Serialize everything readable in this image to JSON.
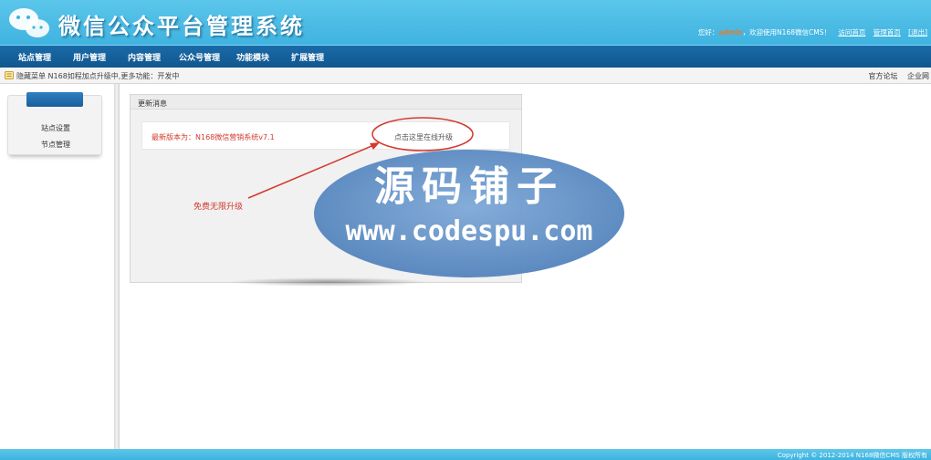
{
  "header": {
    "title": "微信公众平台管理系统",
    "greeting_prefix": "您好：",
    "user": "admin",
    "greeting_suffix": "，欢迎使用N168微信CMS！",
    "links": [
      "访问首页",
      "管理首页",
      "[退出]"
    ]
  },
  "nav": {
    "items": [
      "站点管理",
      "用户管理",
      "内容管理",
      "公众号管理",
      "功能模块",
      "扩展管理"
    ]
  },
  "notice": {
    "text": "隐藏菜单 N168如程加点升级中,更多功能：开发中",
    "right_links": [
      "官方论坛",
      "企业网"
    ]
  },
  "sidebar": {
    "items": [
      "站点设置",
      "节点管理"
    ]
  },
  "panel": {
    "title": "更新消息",
    "version_text": "最新版本为：N168微信营销系统v7.1",
    "upgrade_link": "点击这里在线升级"
  },
  "annotation": {
    "label": "免费无限升级"
  },
  "watermark": {
    "cn": "源码铺子",
    "url": "www.codespu.com"
  },
  "footer": {
    "copyright": "Copyright © 2012-2014 N168微信CMS 版权所有"
  },
  "colors": {
    "header": "#4bbde6",
    "nav": "#1562a0",
    "accent_red": "#d33a2e",
    "watermark": "#5f8fc6"
  }
}
